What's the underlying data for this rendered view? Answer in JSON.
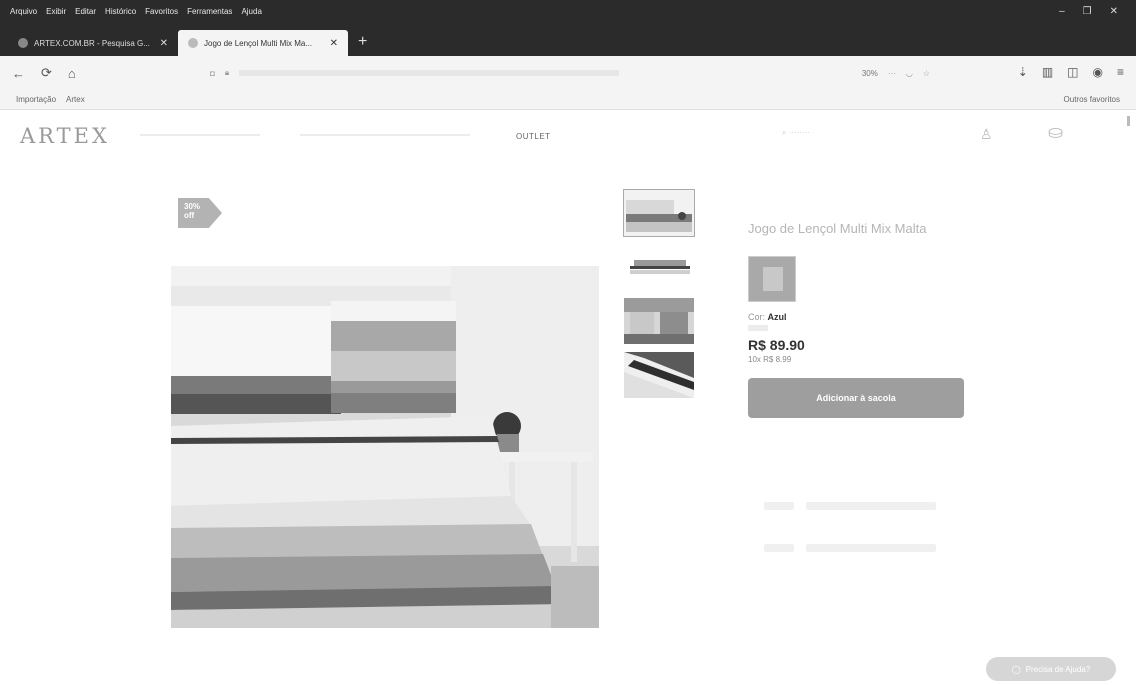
{
  "browser": {
    "menu": [
      "Arquivo",
      "Exibir",
      "Editar",
      "Histórico",
      "Favoritos",
      "Ferramentas",
      "Ajuda"
    ],
    "tabs": [
      {
        "title": "ARTEX.COM.BR - Pesquisa G...",
        "active": false
      },
      {
        "title": "Jogo de Lençol Multi Mix Ma...",
        "active": true
      }
    ],
    "new_tab": "+",
    "zoom": "30%",
    "bookmarks": [
      "Importação",
      "Artex"
    ],
    "other_bookmarks": "Outros favoritos"
  },
  "site": {
    "logo": "ARTEX",
    "nav_outlet": "OUTLET"
  },
  "product": {
    "badge": [
      "30%",
      "off"
    ],
    "title": "Jogo de Lençol Multi Mix Malta",
    "color_label": "Cor:",
    "color_value": "Azul",
    "price": "R$ 89.90",
    "installments": "10x   R$ 8.99",
    "add_to_cart": "Adicionar à sacola"
  },
  "help_button": "Precisa de Ajuda?",
  "colors": {
    "chrome_dark": "#2b2b2b",
    "toolbar": "#f4f4f4",
    "button_gray": "#9e9e9e"
  }
}
